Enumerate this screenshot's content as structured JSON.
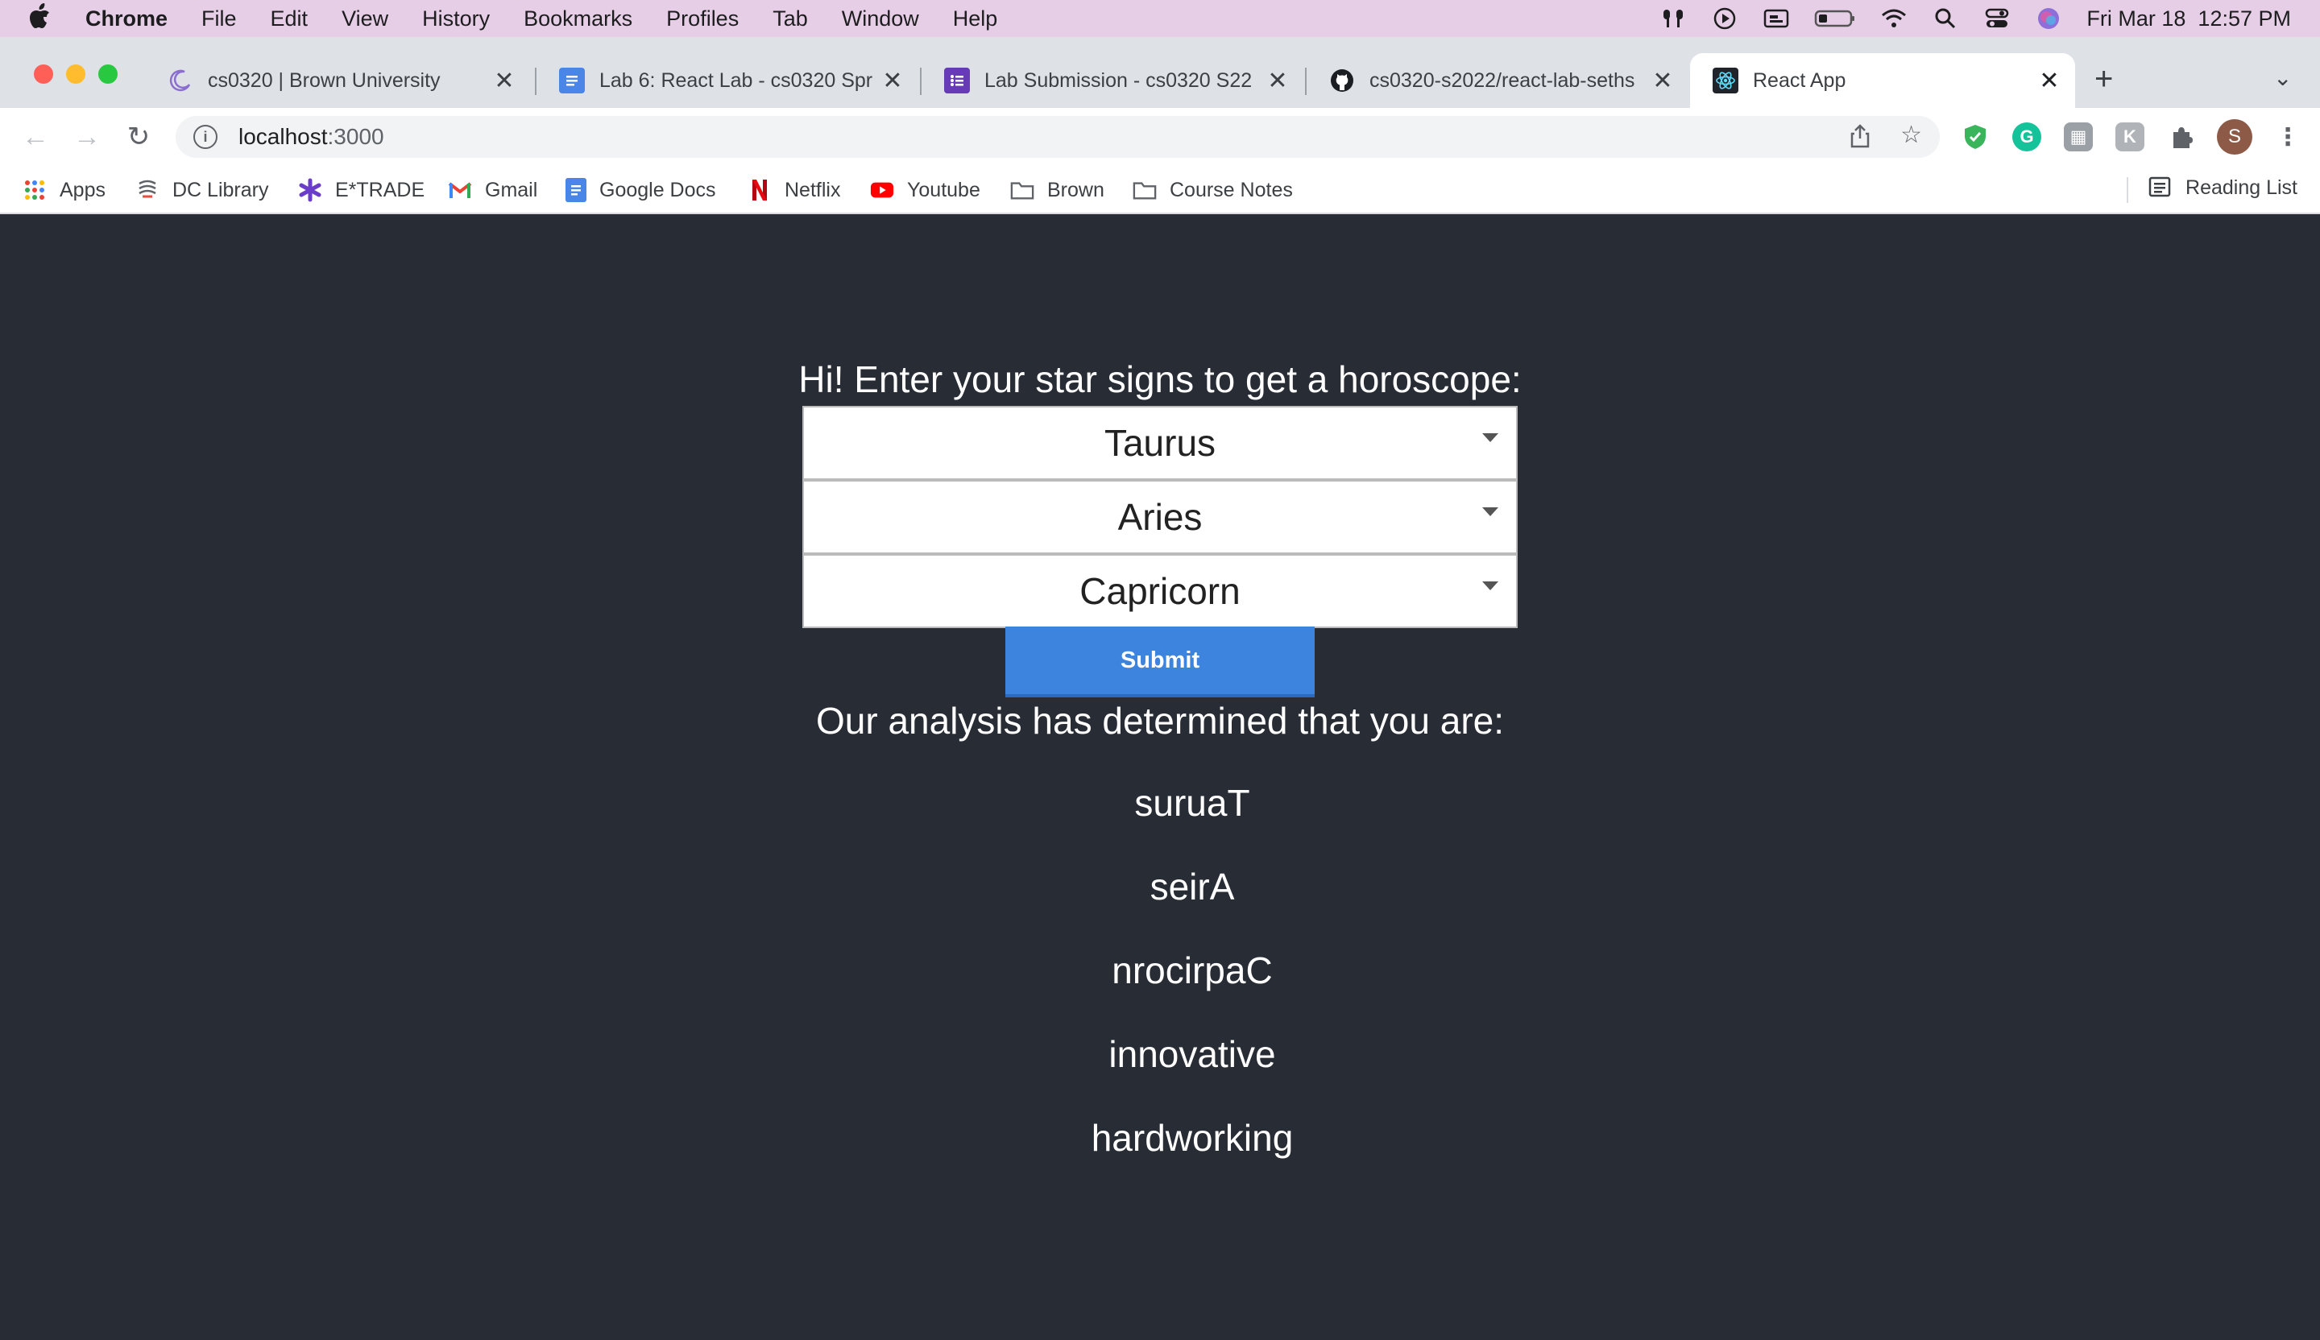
{
  "menubar": {
    "items": [
      "Chrome",
      "File",
      "Edit",
      "View",
      "History",
      "Bookmarks",
      "Profiles",
      "Tab",
      "Window",
      "Help"
    ],
    "clock": "Fri Mar 18  12:57 PM"
  },
  "tabs": [
    {
      "title": "cs0320 | Brown University"
    },
    {
      "title": "Lab 6: React Lab - cs0320 Spr"
    },
    {
      "title": "Lab Submission - cs0320 S22"
    },
    {
      "title": "cs0320-s2022/react-lab-seths"
    },
    {
      "title": "React App"
    }
  ],
  "address": {
    "host": "localhost",
    "port": ":3000"
  },
  "profile_initial": "S",
  "bookmarks": [
    "Apps",
    "DC Library",
    "E*TRADE",
    "Gmail",
    "Google Docs",
    "Netflix",
    "Youtube",
    "Brown",
    "Course Notes"
  ],
  "reading_list": "Reading List",
  "app": {
    "prompt": "Hi! Enter your star signs to get a horoscope:",
    "selects": [
      "Taurus",
      "Aries",
      "Capricorn"
    ],
    "submit": "Submit",
    "analysis_heading": "Our analysis has determined that you are:",
    "results": [
      "suruaT",
      "seirA",
      "nrocirpaC",
      "innovative",
      "hardworking"
    ]
  },
  "colors": {
    "menubar": "#e6cfe6",
    "page_background": "#282c34",
    "submit_button": "#3d84de"
  }
}
